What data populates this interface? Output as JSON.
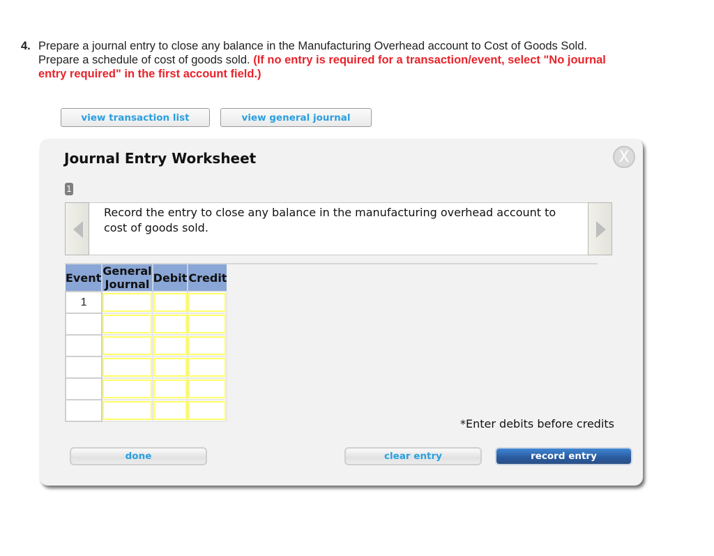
{
  "question": {
    "number": "4.",
    "text": "Prepare a journal entry to close any balance in the Manufacturing Overhead account to Cost of Goods Sold. Prepare a schedule of cost of goods sold.",
    "instruction": "(If no entry is required for a transaction/event, select \"No journal entry required\" in the first account field.)"
  },
  "toolbar": {
    "view_transaction_list": "view transaction list",
    "view_general_journal": "view general journal"
  },
  "worksheet": {
    "title": "Journal Entry Worksheet",
    "close_icon": "X",
    "step_badge": "1",
    "description": "Record the entry to close any balance in the manufacturing overhead account to cost of goods sold.",
    "columns": [
      "Event",
      "General Journal",
      "Debit",
      "Credit"
    ],
    "rows": [
      {
        "event": "1",
        "account": "",
        "debit": "",
        "credit": ""
      },
      {
        "event": "",
        "account": "",
        "debit": "",
        "credit": ""
      },
      {
        "event": "",
        "account": "",
        "debit": "",
        "credit": ""
      },
      {
        "event": "",
        "account": "",
        "debit": "",
        "credit": ""
      },
      {
        "event": "",
        "account": "",
        "debit": "",
        "credit": ""
      },
      {
        "event": "",
        "account": "",
        "debit": "",
        "credit": ""
      }
    ],
    "note": "*Enter debits before credits",
    "buttons": {
      "done": "done",
      "clear_entry": "clear entry",
      "record_entry": "record entry"
    }
  },
  "colors": {
    "instruction_red": "#e8232b",
    "link_blue": "#2a9fe0",
    "header_blue": "#8aa6d6",
    "input_border_yellow": "#ffff66",
    "primary_button": "#2a5a9c"
  }
}
